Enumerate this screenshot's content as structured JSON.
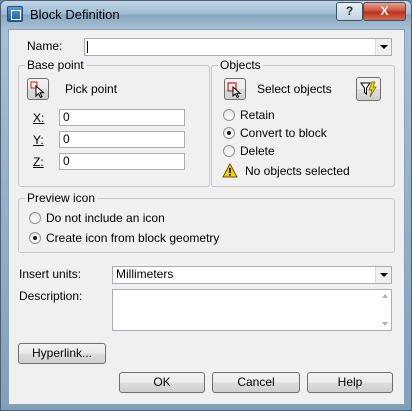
{
  "window": {
    "title": "Block Definition",
    "help_glyph": "?",
    "close_glyph": "X"
  },
  "name": {
    "label": "Name:",
    "value": ""
  },
  "base_point": {
    "title": "Base point",
    "pick_label": "Pick point",
    "x_label": "X:",
    "x_value": "0",
    "y_label": "Y:",
    "y_value": "0",
    "z_label": "Z:",
    "z_value": "0"
  },
  "objects": {
    "title": "Objects",
    "select_label": "Select objects",
    "retain_label": "Retain",
    "convert_label": "Convert to block",
    "delete_label": "Delete",
    "selected_option": "Convert to block",
    "status": "No objects selected"
  },
  "preview": {
    "title": "Preview icon",
    "no_icon_label": "Do not include an icon",
    "create_icon_label": "Create icon from block geometry",
    "selected_option": "Create icon from block geometry"
  },
  "insert_units": {
    "label": "Insert units:",
    "value": "Millimeters"
  },
  "description": {
    "label": "Description:",
    "value": ""
  },
  "buttons": {
    "hyperlink": "Hyperlink...",
    "ok": "OK",
    "cancel": "Cancel",
    "help": "Help"
  },
  "colors": {
    "warning": "#f5d000",
    "title_bar": "#9fbad1",
    "close": "#c94a35"
  }
}
